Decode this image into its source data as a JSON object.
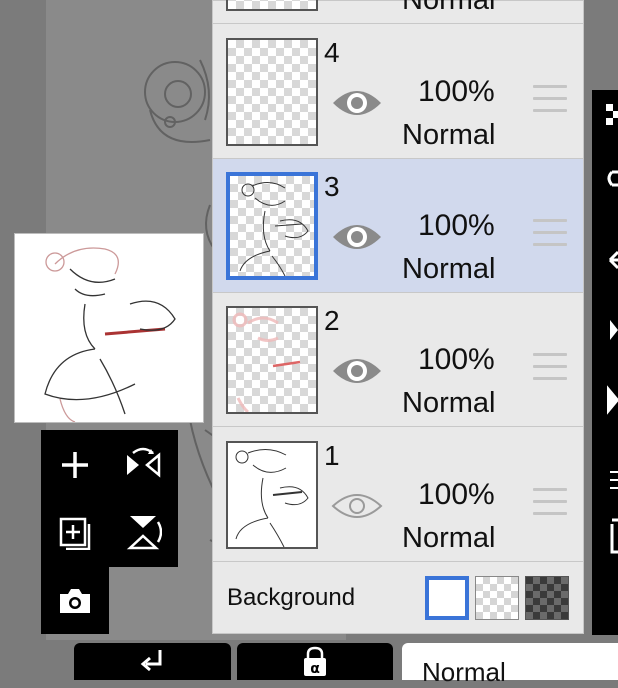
{
  "layers_panel": {
    "layers": [
      {
        "number": "4",
        "opacity": "100%",
        "blend_mode": "Normal",
        "visible": true,
        "selected": false
      },
      {
        "number": "3",
        "opacity": "100%",
        "blend_mode": "Normal",
        "visible": true,
        "selected": true
      },
      {
        "number": "2",
        "opacity": "100%",
        "blend_mode": "Normal",
        "visible": true,
        "selected": false
      },
      {
        "number": "1",
        "opacity": "100%",
        "blend_mode": "Normal",
        "visible": true,
        "selected": false
      }
    ],
    "partial_top_layer_blend": "Normal",
    "background": {
      "label": "Background",
      "options": [
        "white",
        "transparent",
        "dark-checker"
      ],
      "selected": "white"
    }
  },
  "bottom_bar": {
    "blend_mode": "Normal"
  },
  "colors": {
    "selected_layer_bg": "#d1d9ed",
    "selection_border": "#3a74d8",
    "panel_bg": "#e9e9e9",
    "toolbar_bg": "#000000"
  },
  "icons": {
    "left_tools": [
      "add-layer-icon",
      "flip-horizontal-icon",
      "duplicate-layer-icon",
      "flip-vertical-icon",
      "camera-icon"
    ],
    "bottom_buttons": [
      "merge-down-icon",
      "alpha-lock-icon"
    ],
    "right_tools": [
      "checker-icon",
      "move-icon",
      "arrow-left-icon",
      "flip-h-icon",
      "flip-v-icon",
      "merge-icon",
      "trash-icon"
    ]
  }
}
